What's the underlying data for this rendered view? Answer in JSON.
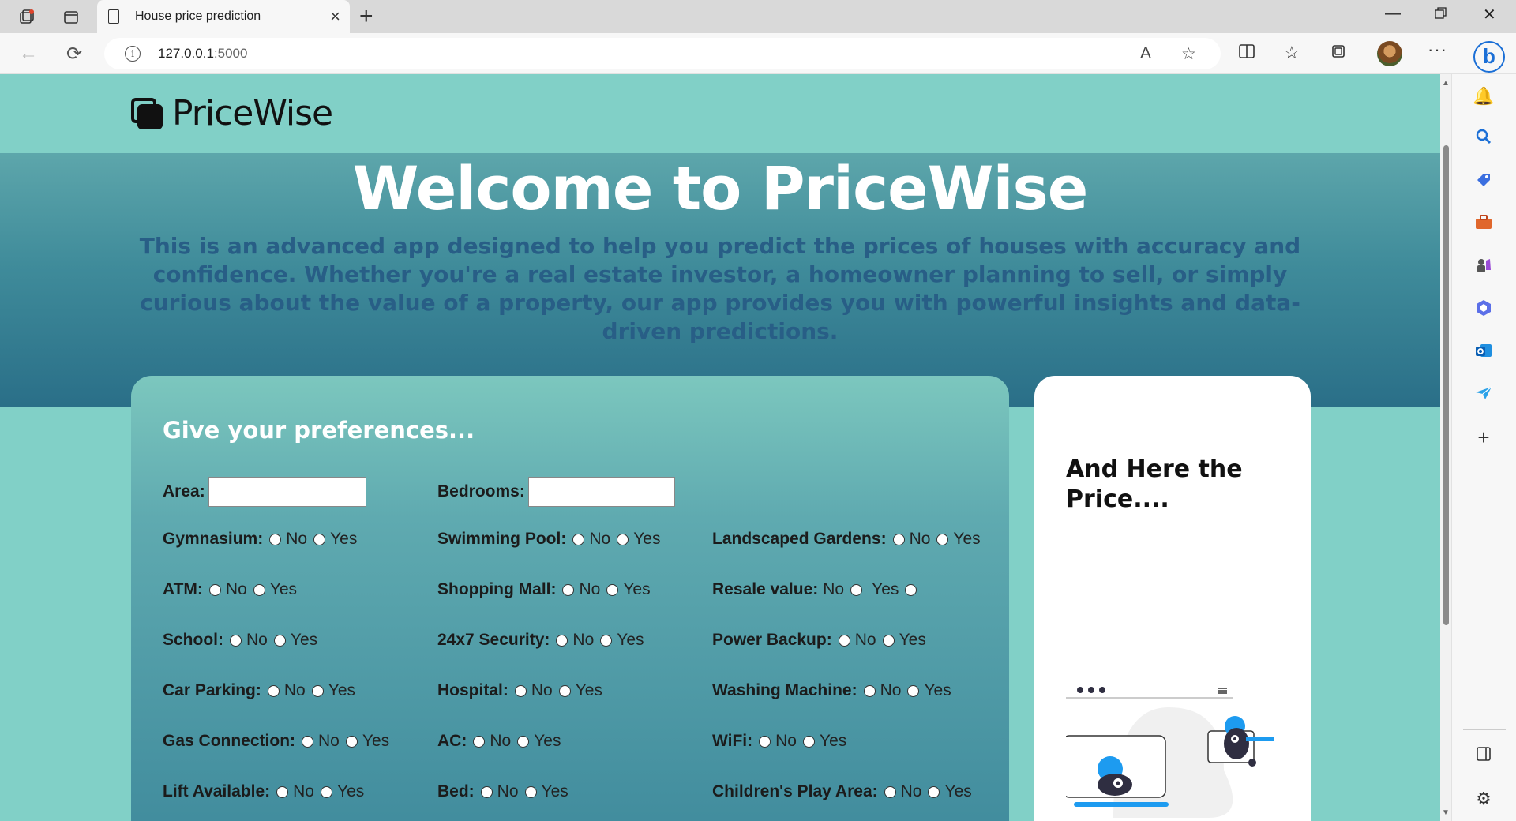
{
  "browser": {
    "tab_title": "House price prediction",
    "url_host": "127.0.0.1",
    "url_port": ":5000"
  },
  "site": {
    "logo_text": "PriceWise"
  },
  "hero": {
    "title": "Welcome to PriceWise",
    "subtitle": "This is an advanced app designed to help you predict the prices of houses with accuracy and confidence. Whether you're a real estate investor, a homeowner planning to sell, or simply curious about the value of a property, our app provides you with powerful insights and data-driven predictions."
  },
  "form": {
    "heading": "Give your preferences...",
    "area_label": "Area:",
    "area_value": "",
    "bedrooms_label": "Bedrooms:",
    "bedrooms_value": "",
    "no_label": "No",
    "yes_label": "Yes",
    "col1": [
      "Gymnasium:",
      "ATM:",
      "School:",
      "Car Parking:",
      "Gas Connection:",
      "Lift Available:"
    ],
    "col2": [
      "Swimming Pool:",
      "Shopping Mall:",
      "24x7 Security:",
      "Hospital:",
      "AC:",
      "Bed:"
    ],
    "col3": [
      "Landscaped Gardens:",
      "Resale value:",
      "Power Backup:",
      "Washing Machine:",
      "WiFi:",
      "Children's Play Area:"
    ]
  },
  "result": {
    "title": "And Here the Price...."
  },
  "colors": {
    "page_bg": "#81d0c7",
    "hero_dark": "#2a6f88",
    "subtitle": "#285e86",
    "accent_blue": "#1d9bf0"
  }
}
